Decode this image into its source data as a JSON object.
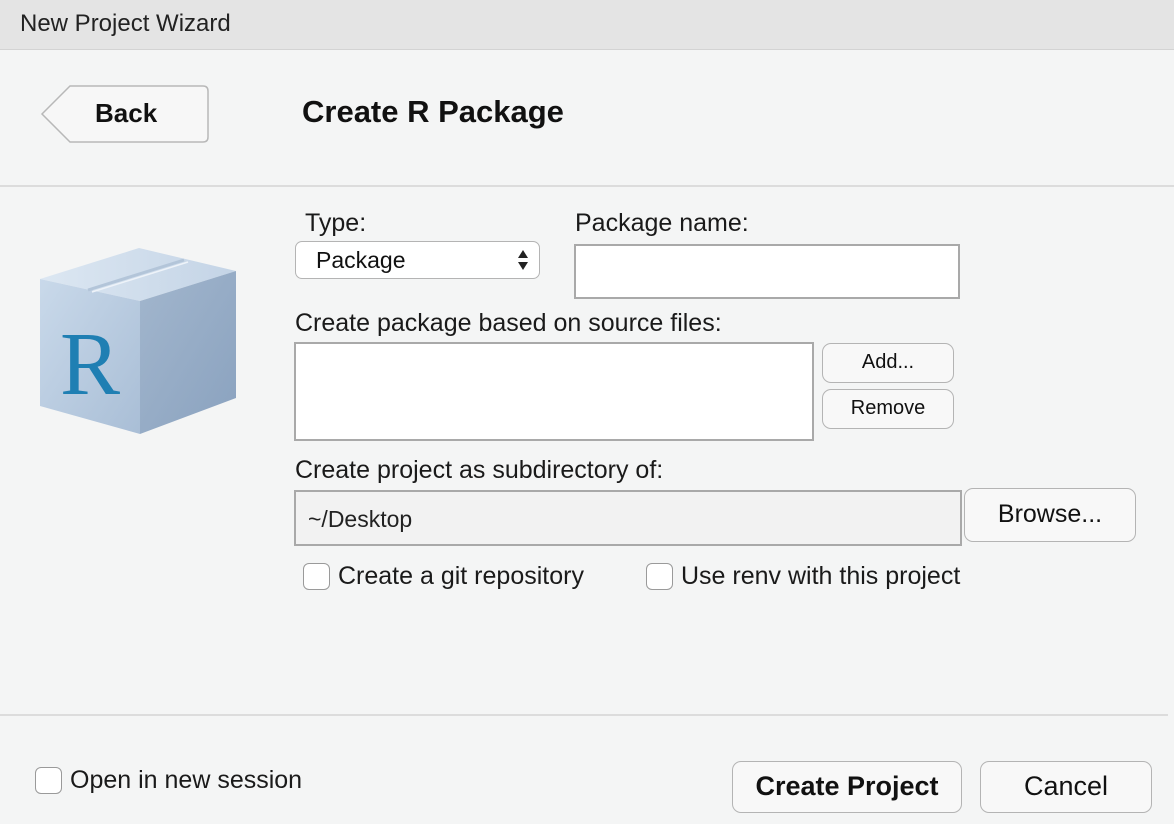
{
  "window": {
    "title": "New Project Wizard"
  },
  "header": {
    "back_label": "Back",
    "page_title": "Create R Package"
  },
  "form": {
    "type_label": "Type:",
    "type_selected": "Package",
    "package_name_label": "Package name:",
    "package_name_value": "",
    "source_files_label": "Create package based on source files:",
    "add_label": "Add...",
    "remove_label": "Remove",
    "subdirectory_label": "Create project as subdirectory of:",
    "subdirectory_value": "~/Desktop",
    "browse_label": "Browse...",
    "git_label": "Create a git repository",
    "git_checked": false,
    "renv_label": "Use renv with this project",
    "renv_checked": false
  },
  "footer": {
    "new_session_label": "Open in new session",
    "new_session_checked": false,
    "create_label": "Create Project",
    "cancel_label": "Cancel"
  },
  "icons": {
    "package": "r-package-box-icon",
    "select_arrows": "up-down-arrows-icon"
  }
}
